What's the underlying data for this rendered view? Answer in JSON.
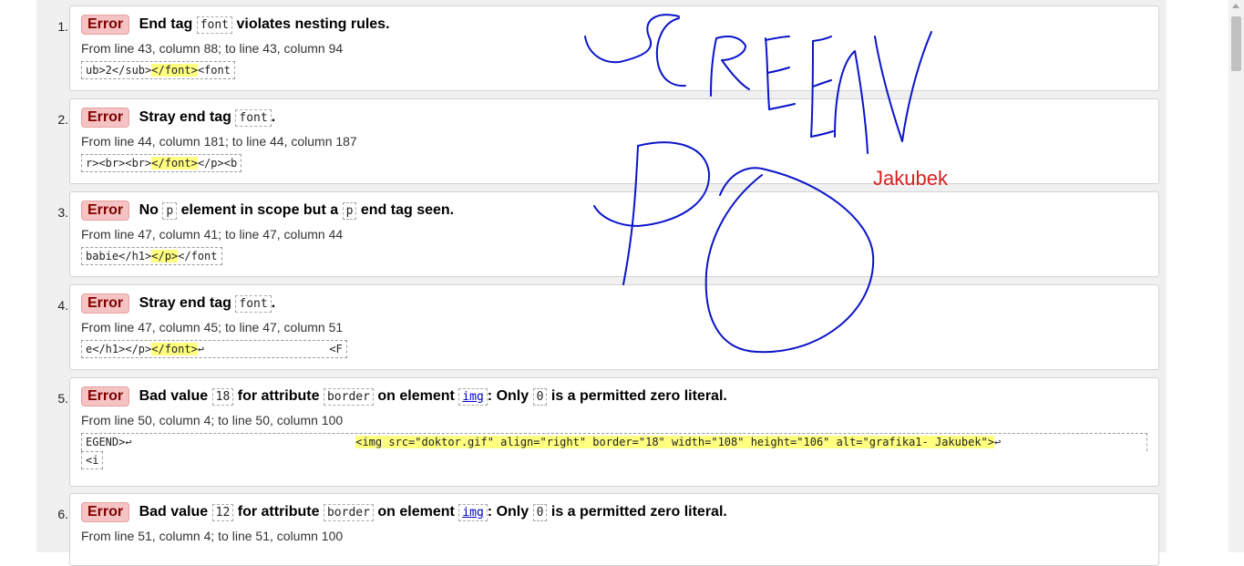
{
  "messages": [
    {
      "num": "1.",
      "badge": "Error",
      "t1": "End tag",
      "c1": "font",
      "t2": "violates nesting rules.",
      "loc": "From line 43, column 88; to line 43, column 94",
      "ext_a": "ub>2</sub>",
      "ext_h": "</font>",
      "ext_b": "<font"
    },
    {
      "num": "2.",
      "badge": "Error",
      "t1": "Stray end tag",
      "c1": "font",
      "t2": ".",
      "loc": "From line 44, column 181; to line 44, column 187",
      "ext_a": "r><br><br>",
      "ext_h": "</font>",
      "ext_b": "</p><b"
    },
    {
      "num": "3.",
      "badge": "Error",
      "t1": "No",
      "c1": "p",
      "t2": "element in scope but a",
      "c2": "p",
      "t3": "end tag seen.",
      "loc": "From line 47, column 41; to line 47, column 44",
      "ext_a": "babie</h1>",
      "ext_h": "</p>",
      "ext_b": "</font"
    },
    {
      "num": "4.",
      "badge": "Error",
      "t1": "Stray end tag",
      "c1": "font",
      "t2": ".",
      "loc": "From line 47, column 45; to line 47, column 51",
      "ext_a": "e</h1></p>",
      "ext_h": "</font>",
      "ext_b": "↩                   <F"
    },
    {
      "num": "5.",
      "badge": "Error",
      "t1": "Bad value",
      "c1": "18",
      "t2": "for attribute",
      "c2": "border",
      "t3": "on element",
      "c3": "img",
      "t4": ": Only",
      "c4": "0",
      "t5": "is a permitted zero literal.",
      "loc": "From line 50, column 4; to line 50, column 100",
      "ext_a": "EGEND>↩                                  ",
      "ext_h": "<img src=\"doktor.gif\" align=\"right\" border=\"18\" width=\"108\" height=\"106\" alt=\"grafika1- Jakubek\">",
      "ext_b": "↩",
      "ext2": "<i"
    },
    {
      "num": "6.",
      "badge": "Error",
      "t1": "Bad value",
      "c1": "12",
      "t2": "for attribute",
      "c2": "border",
      "t3": "on element",
      "c3": "img",
      "t4": ": Only",
      "c4": "0",
      "t5": "is a permitted zero literal.",
      "loc": "From line 51, column 4; to line 51, column 100"
    }
  ],
  "annotation": {
    "handwriting": "SCREEN PO",
    "signature": "Jakubek",
    "ink_color": "#0a14c8",
    "signature_color": "#d62020"
  }
}
